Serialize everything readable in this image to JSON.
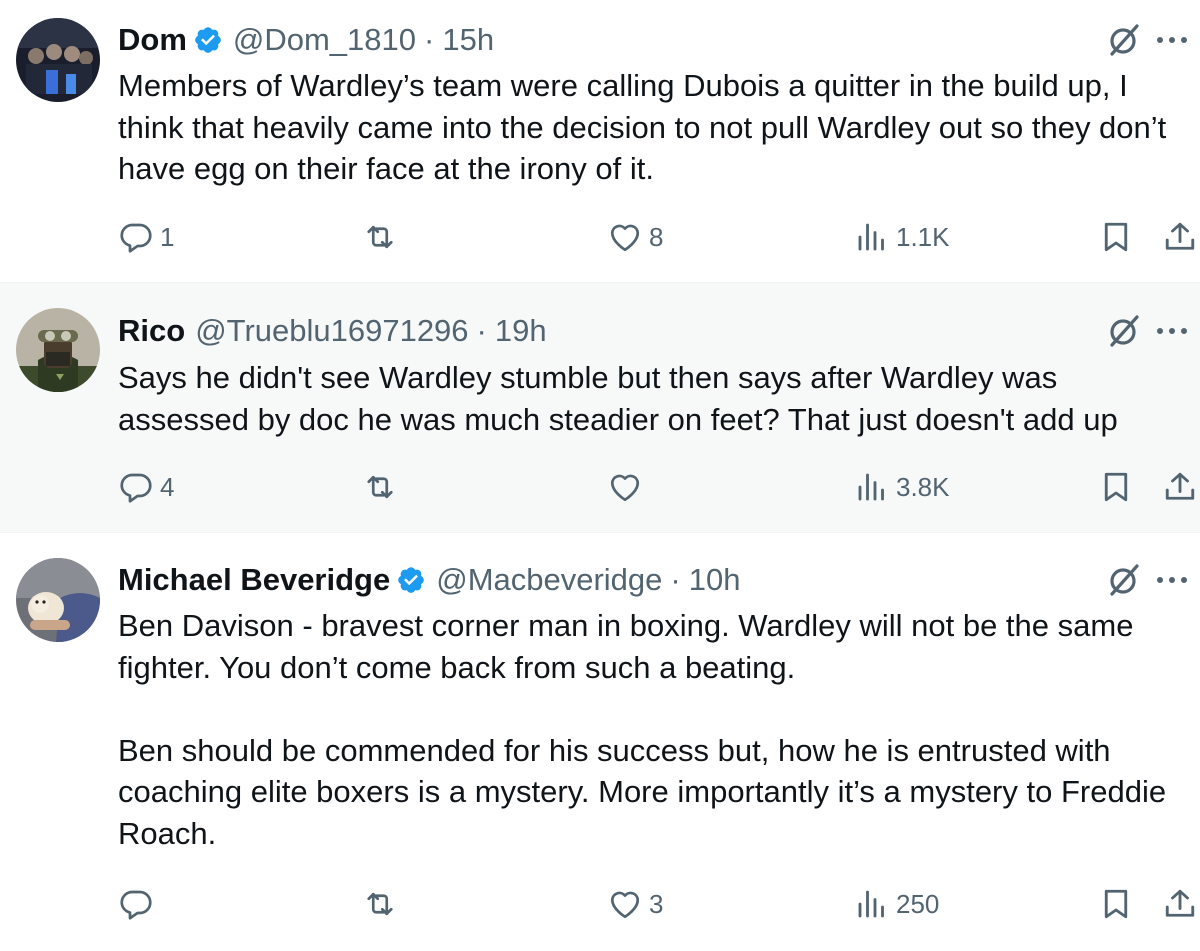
{
  "tweets": [
    {
      "name": "Dom",
      "handle": "@Dom_1810",
      "separator": "·",
      "time": "15h",
      "verified": true,
      "text": [
        "Members of Wardley’s team were calling Dubois a quitter in the build up, I think that heavily came into the decision to not pull Wardley out so they don’t have egg on their face at the irony of it."
      ],
      "replies": "1",
      "reposts": "",
      "likes": "8",
      "views": "1.1K"
    },
    {
      "name": "Rico",
      "handle": "@Trueblu16971296",
      "separator": "·",
      "time": "19h",
      "verified": false,
      "text": [
        "Says he didn't see Wardley stumble but then says after Wardley was assessed by doc he was much steadier on feet? That just doesn't add up"
      ],
      "replies": "4",
      "reposts": "",
      "likes": "",
      "views": "3.8K"
    },
    {
      "name": "Michael Beveridge",
      "handle": "@Macbeveridge",
      "separator": "·",
      "time": "10h",
      "verified": true,
      "text": [
        "Ben Davison - bravest corner man in boxing. Wardley will not be the same fighter. You don’t come back from such a beating.",
        "Ben should be commended for his success but, how he is entrusted with coaching elite boxers is a mystery.  More importantly it’s a mystery to Freddie Roach."
      ],
      "replies": "",
      "reposts": "",
      "likes": "3",
      "views": "250"
    }
  ],
  "icons": {
    "verified": "verified-badge-icon",
    "grok": "grok-icon",
    "more": "more-icon",
    "reply": "reply-icon",
    "repost": "repost-icon",
    "like": "like-icon",
    "views": "views-icon",
    "bookmark": "bookmark-icon",
    "share": "share-icon"
  },
  "colors": {
    "text": "#0f1419",
    "secondary": "#536471",
    "verified": "#1d9bf0",
    "highlight_bg": "#f7f9f9",
    "divider": "#eff3f4"
  }
}
